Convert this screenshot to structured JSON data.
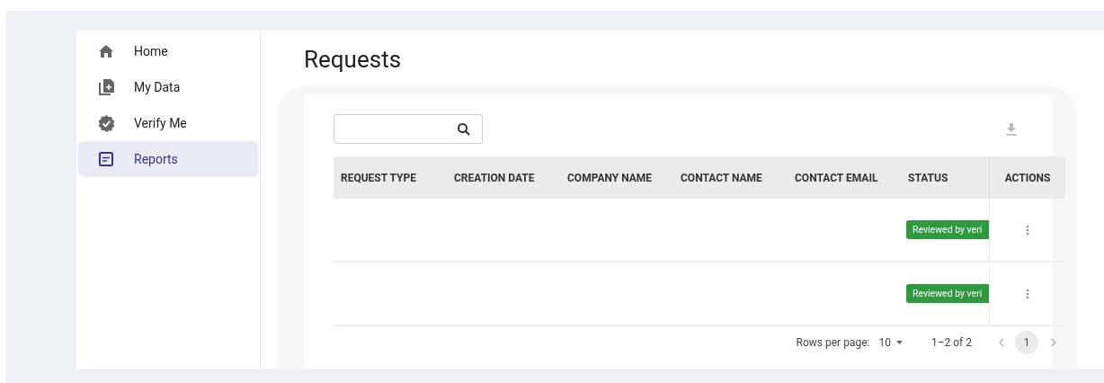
{
  "sidebar": {
    "items": [
      {
        "label": "Home",
        "kind": "home",
        "selected": false
      },
      {
        "label": "My Data",
        "kind": "data",
        "selected": false
      },
      {
        "label": "Verify Me",
        "kind": "verify",
        "selected": false
      },
      {
        "label": "Reports",
        "kind": "reports",
        "selected": true
      }
    ]
  },
  "page_title": "Requests",
  "table": {
    "columns": [
      "REQUEST TYPE",
      "CREATION DATE",
      "COMPANY NAME",
      "CONTACT NAME",
      "CONTACT EMAIL",
      "STATUS",
      "ACTIONS"
    ],
    "rows": [
      {
        "status": "Reviewed by veri"
      },
      {
        "status": "Reviewed by veri"
      }
    ]
  },
  "pagination": {
    "rows_per_page_label": "Rows per page:",
    "rows_per_page": "10",
    "range": "1–2 of 2",
    "pages": [
      {
        "label": "1",
        "selected": true
      }
    ]
  }
}
